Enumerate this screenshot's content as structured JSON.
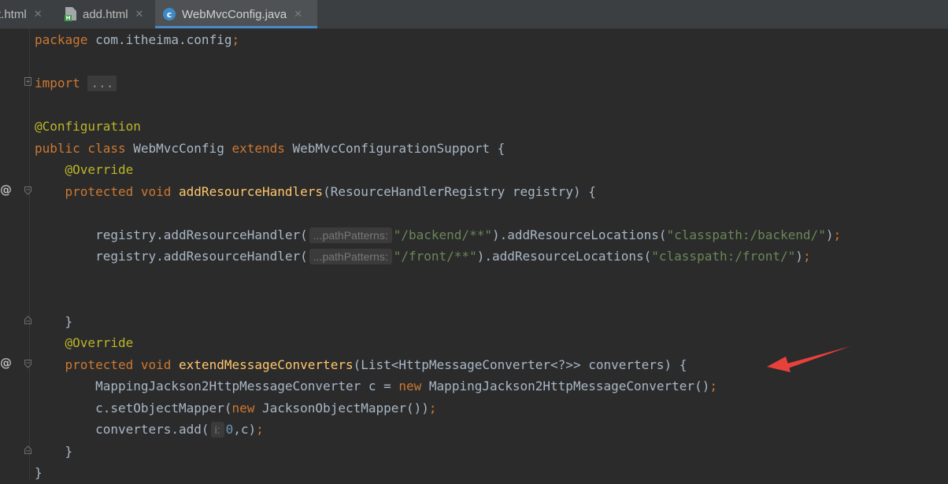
{
  "tabs": [
    {
      "label": "t.html",
      "close": "✕",
      "icon": "html-file-icon"
    },
    {
      "label": "add.html",
      "close": "✕",
      "icon": "html-file-icon"
    },
    {
      "label": "WebMvcConfig.java",
      "close": "✕",
      "icon": "java-class-icon",
      "icon_letter": "c",
      "active": true
    }
  ],
  "gutter": {
    "override_marker": "@"
  },
  "code": {
    "l1": {
      "kw": "package",
      "rest": " com.itheima.config",
      "semi": ";"
    },
    "l3": {
      "kw": "import",
      "folded": "..."
    },
    "l5": {
      "ann": "@Configuration"
    },
    "l6": {
      "kw1": "public class",
      "name": " WebMvcConfig ",
      "kw2": "extends",
      "rest": " WebMvcConfigurationSupport {"
    },
    "l7": {
      "ann": "@Override"
    },
    "l8": {
      "kw": "protected void",
      "fn": "addResourceHandlers",
      "rest": "(ResourceHandlerRegistry registry) {"
    },
    "l10": {
      "pre": "registry.addResourceHandler(",
      "hint": "...pathPatterns:",
      "str1": "\"/backend/**\"",
      "mid": ").addResourceLocations(",
      "str2": "\"classpath:/backend/\"",
      "end": ")",
      "semi": ";"
    },
    "l11": {
      "pre": "registry.addResourceHandler(",
      "hint": "...pathPatterns:",
      "str1": "\"/front/**\"",
      "mid": ").addResourceLocations(",
      "str2": "\"classpath:/front/\"",
      "end": ")",
      "semi": ";"
    },
    "l14": {
      "brace": "}"
    },
    "l15": {
      "ann": "@Override"
    },
    "l16": {
      "kw": "protected void",
      "fn": "extendMessageConverters",
      "rest": "(List<HttpMessageConverter<?>> converters) {"
    },
    "l17": {
      "pre": "MappingJackson2HttpMessageConverter c = ",
      "kw": "new",
      "rest": " MappingJackson2HttpMessageConverter()",
      "semi": ";"
    },
    "l18": {
      "pre": "c.setObjectMapper(",
      "kw": "new",
      "rest": " JacksonObjectMapper())",
      "semi": ";"
    },
    "l19": {
      "pre": "converters.add(",
      "hint": "i:",
      "num": "0",
      "rest": ",c)",
      "semi": ";"
    },
    "l20": {
      "brace": "}"
    },
    "l21": {
      "brace": "}"
    }
  },
  "colors": {
    "keyword": "#cc7832",
    "annotation": "#bbb529",
    "method": "#ffc66d",
    "string": "#6a8759",
    "number": "#6897bb",
    "arrow": "#e8413b"
  }
}
